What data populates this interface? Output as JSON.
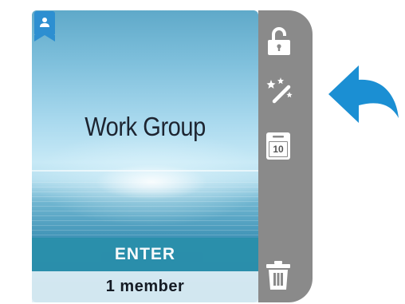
{
  "card": {
    "title": "Work Group",
    "enter_label": "ENTER",
    "member_count": "1 member"
  },
  "sidebar": {
    "icons": [
      "unlock-icon",
      "magic-wand-icon",
      "calendar-icon",
      "trash-icon"
    ],
    "calendar_day": "10"
  },
  "colors": {
    "badge": "#2d8fd1",
    "enter_bar": "#2a8fab",
    "sidebar": "#8a8a8a",
    "arrow": "#1b8fd3"
  }
}
